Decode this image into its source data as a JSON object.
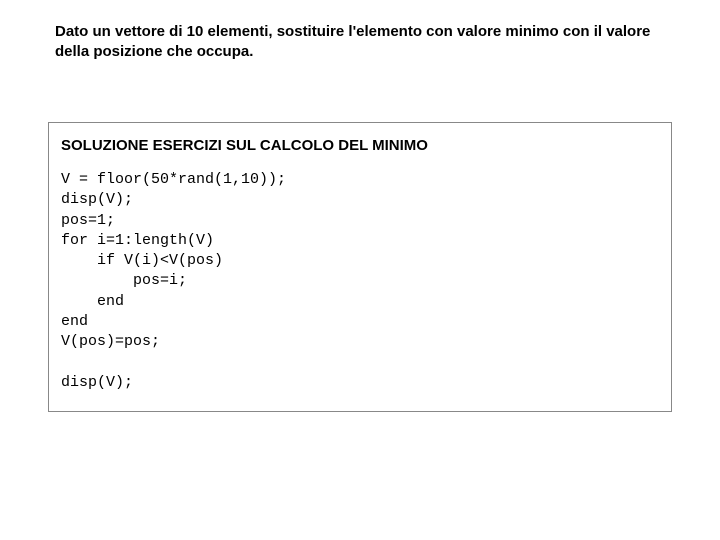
{
  "problem": {
    "text": "Dato un vettore di 10 elementi, sostituire l'elemento con valore minimo con il valore della posizione che occupa."
  },
  "solution": {
    "title": "SOLUZIONE ESERCIZI SUL CALCOLO DEL MINIMO",
    "code_lines": [
      "V = floor(50*rand(1,10));",
      "disp(V);",
      "pos=1;",
      "for i=1:length(V)",
      "    if V(i)<V(pos)",
      "        pos=i;",
      "    end",
      "end",
      "V(pos)=pos;",
      "",
      "disp(V);"
    ]
  }
}
